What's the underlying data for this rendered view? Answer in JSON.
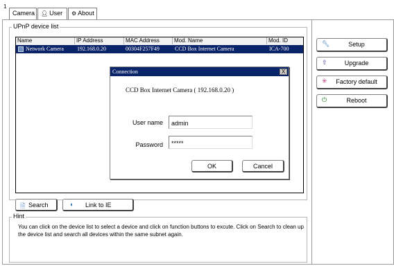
{
  "tabs": {
    "index": "1",
    "items": [
      {
        "label": "Camera"
      },
      {
        "label": "User"
      },
      {
        "label": "About"
      }
    ]
  },
  "device_list": {
    "group_title": "UPnP device list",
    "columns": [
      "Name",
      "IP Address",
      "MAC Address",
      "Mod. Name",
      "Mod. ID"
    ],
    "rows": [
      {
        "name": "Network Camera",
        "ip": "192.168.0.20",
        "mac": "00304F257F49",
        "mod_name": "CCD Box Internet Camera",
        "mod_id": "ICA-700",
        "selected": true
      }
    ]
  },
  "bottom_buttons": {
    "search": "Search",
    "link_to_ie": "Link to IE"
  },
  "side_buttons": {
    "setup": "Setup",
    "upgrade": "Upgrade",
    "factory_default": "Factory default",
    "reboot": "Reboot"
  },
  "dialog": {
    "title": "Connection",
    "close_label": "X",
    "info": "CCD Box Internet Camera ( 192.168.0.20 )",
    "username_label": "User name",
    "username_value": "admin",
    "password_label": "Password",
    "password_value": "*****",
    "ok": "OK",
    "cancel": "Cancel"
  },
  "hint": {
    "group_title": "Hint",
    "text": "You can click on the device list to select a device and click on function buttons to excute. Click on Search to clean up the device list and search all devices  within the same subnet again."
  },
  "colors": {
    "selection": "#0a246a",
    "setup_icon": "#2a6bb5",
    "upgrade_icon": "#3a3a8a",
    "factory_icon": "#c0307a",
    "reboot_icon": "#1a7a1a"
  }
}
